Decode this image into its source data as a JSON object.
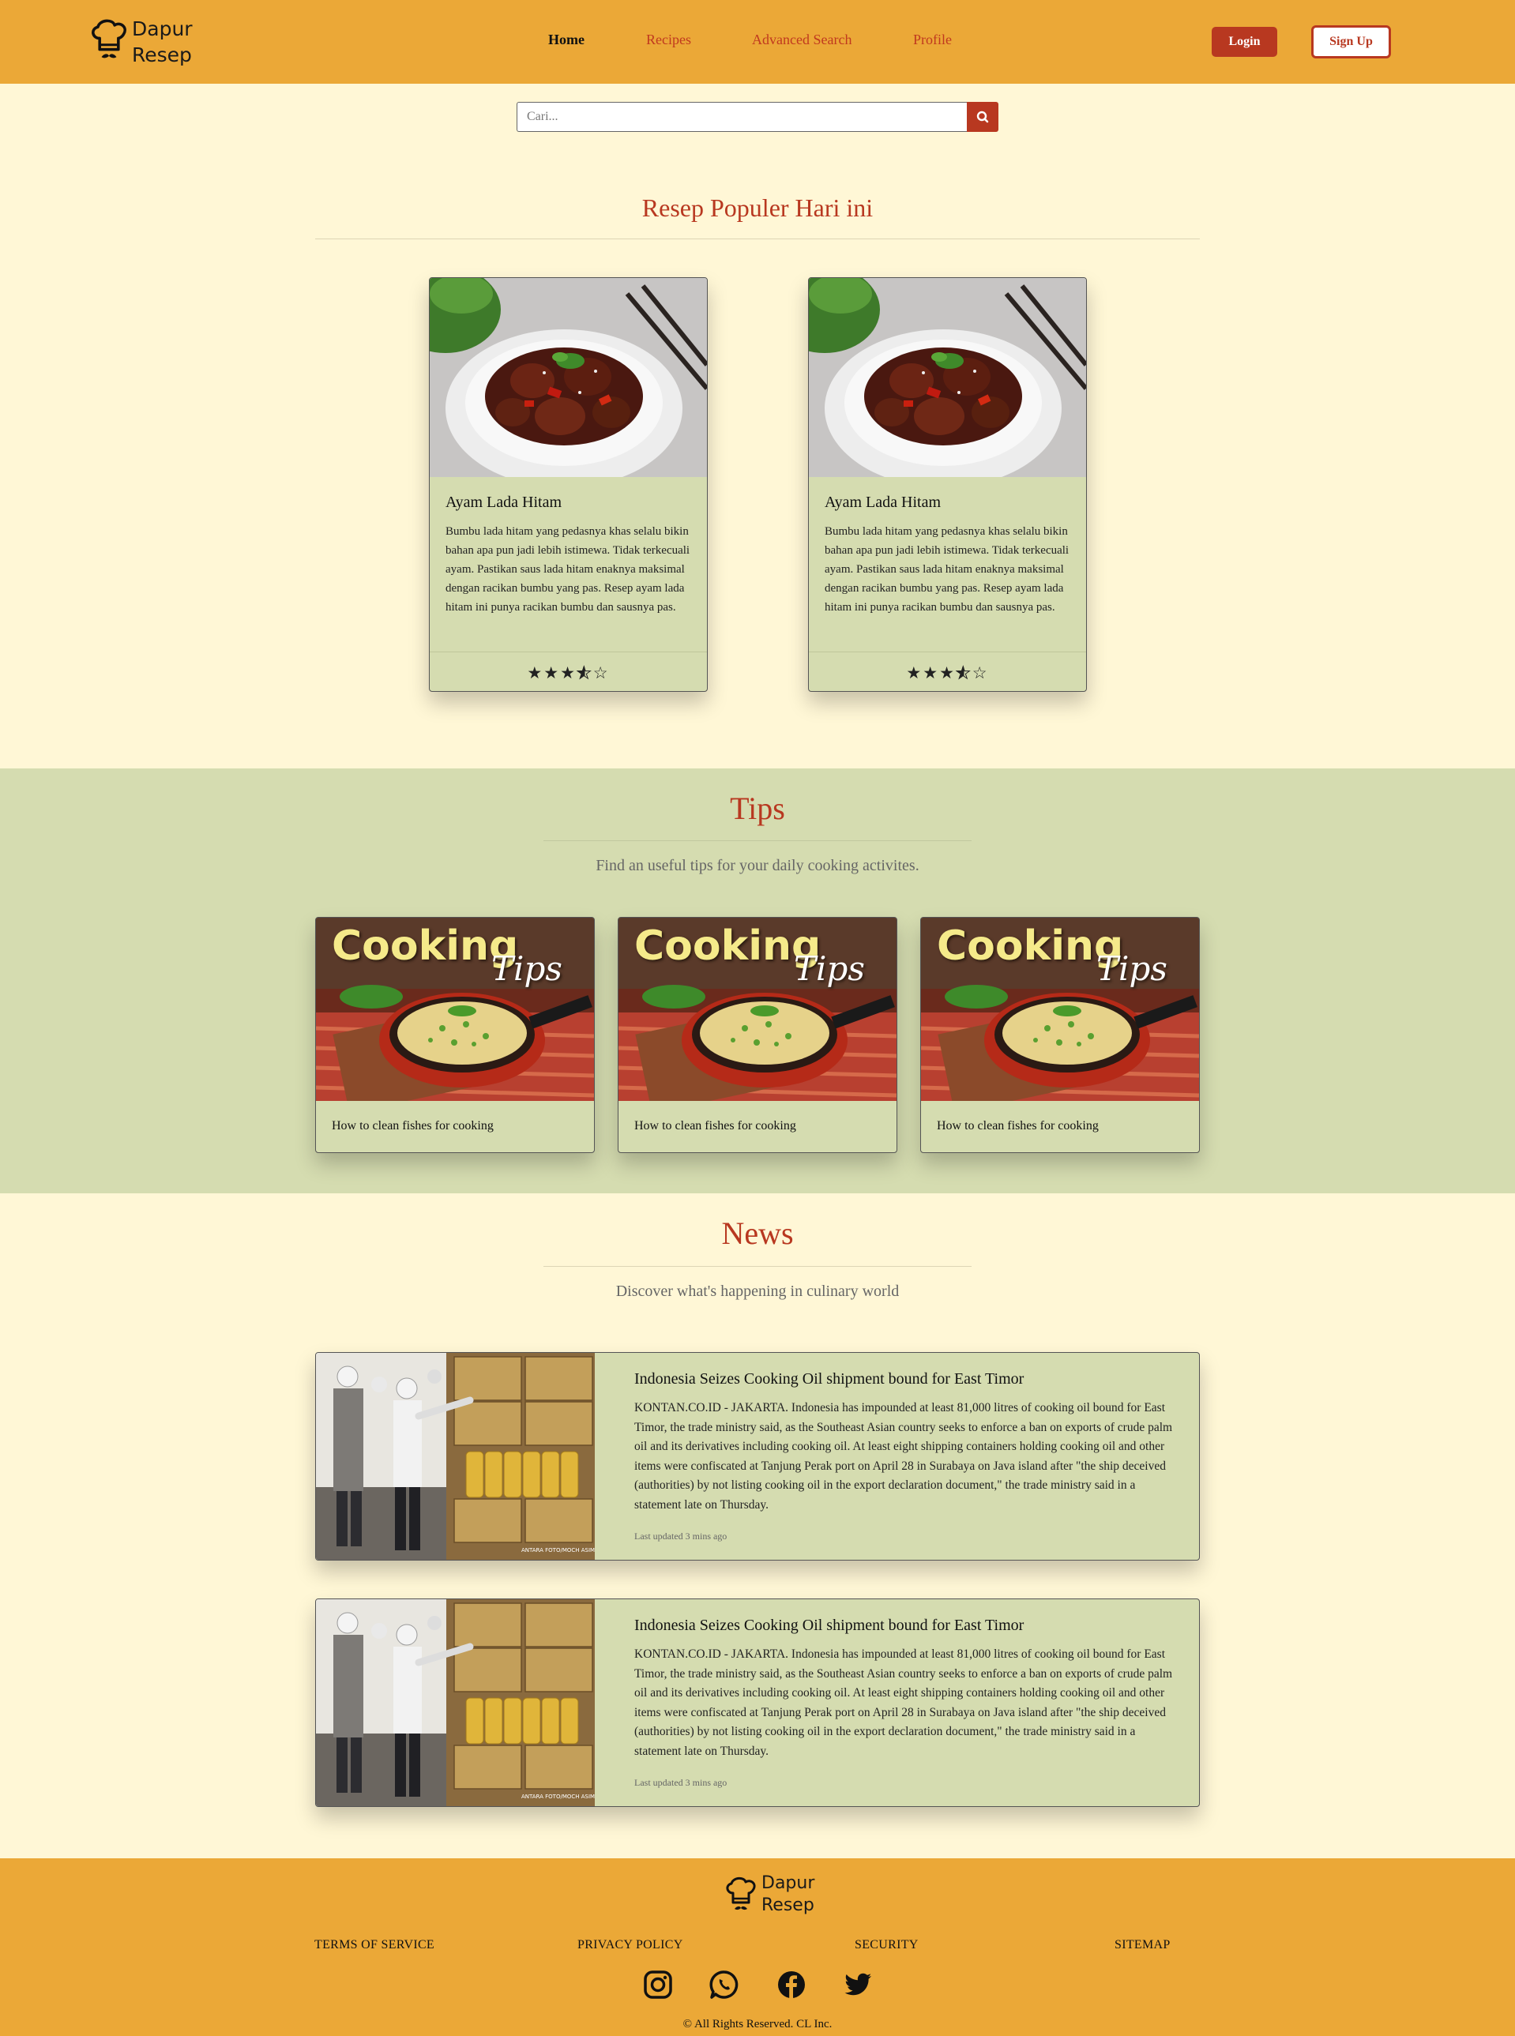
{
  "brand": {
    "line1": "Dapur",
    "line2": "Resep"
  },
  "nav": {
    "home": "Home",
    "recipes": "Recipes",
    "advanced_search": "Advanced Search",
    "profile": "Profile"
  },
  "auth": {
    "login": "Login",
    "signup": "Sign Up"
  },
  "search": {
    "placeholder": "Cari...",
    "button_icon": "search-icon"
  },
  "popular": {
    "title": "Resep Populer Hari ini",
    "cards": [
      {
        "title": "Ayam Lada Hitam",
        "description": "Bumbu lada hitam yang pedasnya khas selalu bikin bahan apa pun jadi lebih istimewa. Tidak terkecuali ayam. Pastikan saus lada hitam enaknya maksimal dengan racikan bumbu yang pas. Resep ayam lada hitam ini punya racikan bumbu dan sausnya pas.",
        "rating": 3.5,
        "max_rating": 5
      },
      {
        "title": "Ayam Lada Hitam",
        "description": "Bumbu lada hitam yang pedasnya khas selalu bikin bahan apa pun jadi lebih istimewa. Tidak terkecuali ayam. Pastikan saus lada hitam enaknya maksimal dengan racikan bumbu yang pas. Resep ayam lada hitam ini punya racikan bumbu dan sausnya pas.",
        "rating": 3.5,
        "max_rating": 5
      }
    ]
  },
  "tips": {
    "title": "Tips",
    "subtitle": "Find an useful tips for your daily cooking activites.",
    "image_text": {
      "word1": "Cooking",
      "word2": "Tips"
    },
    "cards": [
      {
        "label": "How to clean fishes for cooking"
      },
      {
        "label": "How to clean fishes for cooking"
      },
      {
        "label": "How to clean fishes for cooking"
      }
    ]
  },
  "news": {
    "title": "News",
    "subtitle": "Discover what's happening in culinary world",
    "photo_credit": "ANTARA FOTO/MOCH ASIM",
    "items": [
      {
        "title": "Indonesia Seizes Cooking Oil shipment bound for East Timor",
        "body": "KONTAN.CO.ID - JAKARTA. Indonesia has impounded at least 81,000 litres of cooking oil bound for East Timor, the trade ministry said, as the Southeast Asian country seeks to enforce a ban on exports of crude palm oil and its derivatives including cooking oil. At least eight shipping containers holding cooking oil and other items were confiscated at Tanjung Perak port on April 28 in Surabaya on Java island after \"the ship deceived (authorities) by not listing cooking oil in the export declaration document,\" the trade ministry said in a statement late on Thursday.",
        "updated": "Last updated 3 mins ago"
      },
      {
        "title": "Indonesia Seizes Cooking Oil shipment bound for East Timor",
        "body": "KONTAN.CO.ID - JAKARTA. Indonesia has impounded at least 81,000 litres of cooking oil bound for East Timor, the trade ministry said, as the Southeast Asian country seeks to enforce a ban on exports of crude palm oil and its derivatives including cooking oil. At least eight shipping containers holding cooking oil and other items were confiscated at Tanjung Perak port on April 28 in Surabaya on Java island after \"the ship deceived (authorities) by not listing cooking oil in the export declaration document,\" the trade ministry said in a statement late on Thursday.",
        "updated": "Last updated 3 mins ago"
      }
    ]
  },
  "footer": {
    "links": {
      "terms": "TERMS OF SERVICE",
      "privacy": "PRIVACY POLICY",
      "security": "SECURITY",
      "sitemap": "SITEMAP"
    },
    "social_icons": [
      "instagram-icon",
      "whatsapp-icon",
      "facebook-icon",
      "twitter-icon"
    ],
    "copyright": "© All Rights Reserved. CL Inc."
  },
  "colors": {
    "header": "#eba837",
    "page_bg": "#fff7d6",
    "card_bg": "#d5dcb0",
    "accent": "#b83820"
  }
}
